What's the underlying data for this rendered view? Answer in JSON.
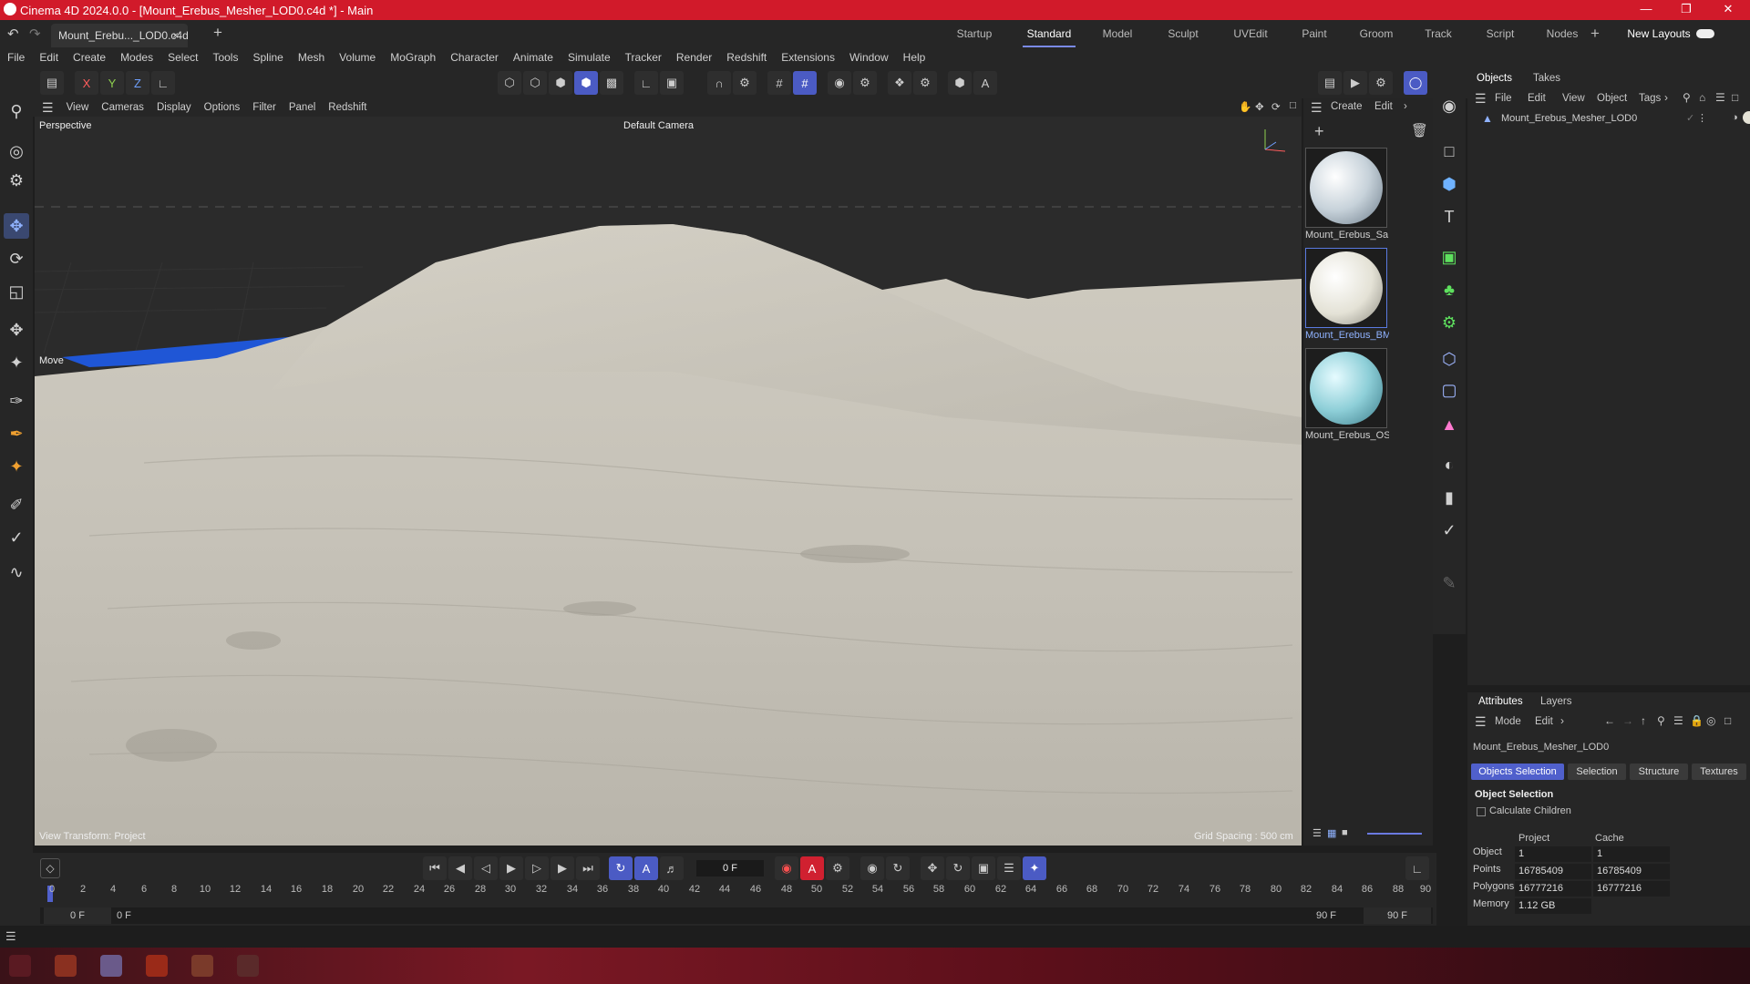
{
  "window": {
    "title": "Cinema 4D 2024.0.0 - [Mount_Erebus_Mesher_LOD0.c4d *] - Main",
    "doc_tab": "Mount_Erebu..._LOD0.c4d *"
  },
  "layouts": [
    "Startup",
    "Standard",
    "Model",
    "Sculpt",
    "UVEdit",
    "Paint",
    "Groom",
    "Track",
    "Script",
    "Nodes"
  ],
  "new_layouts": "New Layouts",
  "menu": [
    "File",
    "Edit",
    "Create",
    "Modes",
    "Select",
    "Tools",
    "Spline",
    "Mesh",
    "Volume",
    "MoGraph",
    "Character",
    "Animate",
    "Simulate",
    "Tracker",
    "Render",
    "Redshift",
    "Extensions",
    "Window",
    "Help"
  ],
  "axis_labels": {
    "x": "X",
    "y": "Y",
    "z": "Z"
  },
  "viewport_menu": [
    "View",
    "Cameras",
    "Display",
    "Options",
    "Filter",
    "Panel",
    "Redshift"
  ],
  "viewport": {
    "name": "Perspective",
    "camera": "Default Camera",
    "move_label": "Move",
    "view_transform": "View Transform: Project",
    "grid_spacing": "Grid Spacing : 500 cm"
  },
  "material_panel": {
    "menu": [
      "Create",
      "Edit"
    ],
    "materials": [
      {
        "name": "Mount_Erebus_Sa",
        "color": "#c7d2da"
      },
      {
        "name": "Mount_Erebus_BM",
        "color": "#e4e2d6"
      },
      {
        "name": "Mount_Erebus_OS",
        "color": "#8ecfd8"
      }
    ]
  },
  "objects_panel": {
    "tabs": [
      "Objects",
      "Takes"
    ],
    "menu": [
      "File",
      "Edit",
      "View",
      "Object",
      "Tags"
    ],
    "items": [
      "Mount_Erebus_Mesher_LOD0"
    ]
  },
  "attributes_panel": {
    "tabs": [
      "Attributes",
      "Layers"
    ],
    "menu": [
      "Mode",
      "Edit"
    ],
    "object_name": "Mount_Erebus_Mesher_LOD0",
    "buttons": [
      "Objects Selection",
      "Selection",
      "Structure",
      "Textures"
    ],
    "section_title": "Object Selection",
    "calculate_children": "Calculate Children",
    "col_project": "Project",
    "col_cache": "Cache",
    "rows": [
      {
        "label": "Object",
        "project": "1",
        "cache": "1"
      },
      {
        "label": "Points",
        "project": "16785409",
        "cache": "16785409"
      },
      {
        "label": "Polygons",
        "project": "16777216",
        "cache": "16777216"
      },
      {
        "label": "Memory",
        "project": "1.12 GB",
        "cache": ""
      }
    ]
  },
  "timeline": {
    "current_frame": "0 F",
    "ticks": [
      "0",
      "2",
      "4",
      "6",
      "8",
      "10",
      "12",
      "14",
      "16",
      "18",
      "20",
      "22",
      "24",
      "26",
      "28",
      "30",
      "32",
      "34",
      "36",
      "38",
      "40",
      "42",
      "44",
      "46",
      "48",
      "50",
      "52",
      "54",
      "56",
      "58",
      "60",
      "62",
      "64",
      "66",
      "68",
      "70",
      "72",
      "74",
      "76",
      "78",
      "80",
      "82",
      "84",
      "86",
      "88",
      "90"
    ],
    "start": "0 F",
    "start2": "0 F",
    "end": "90 F",
    "end2": "90 F"
  }
}
